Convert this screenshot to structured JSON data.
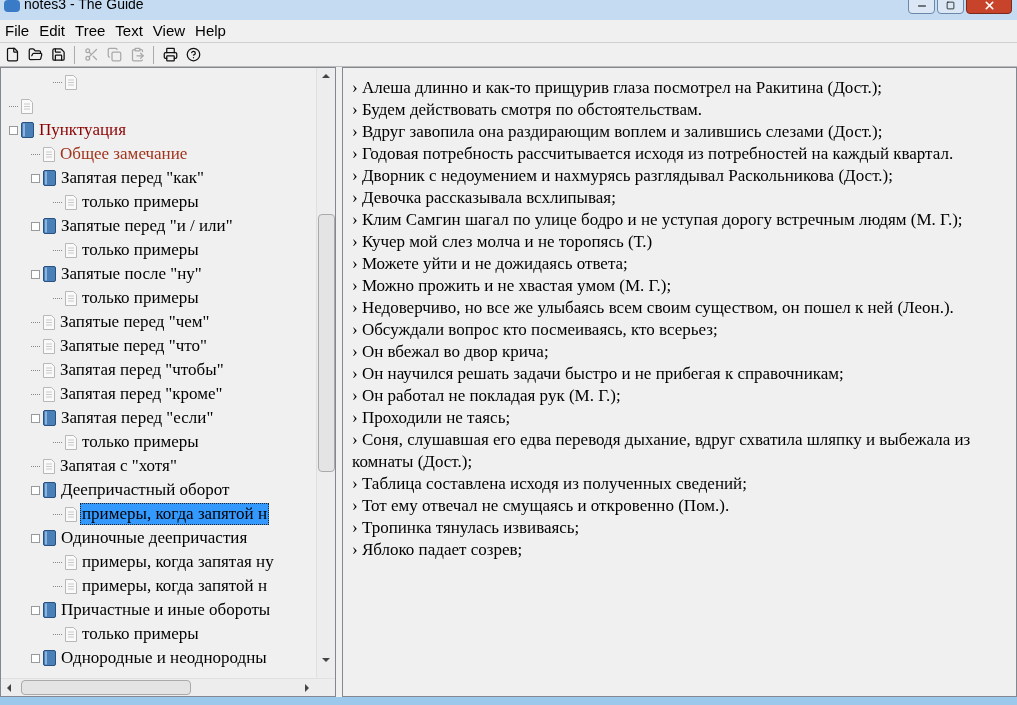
{
  "window": {
    "title": "notes3 - The Guide"
  },
  "menu": [
    "File",
    "Edit",
    "Tree",
    "Text",
    "View",
    "Help"
  ],
  "toolbar": [
    {
      "kind": "new",
      "disabled": false
    },
    {
      "kind": "open",
      "disabled": false
    },
    {
      "kind": "save",
      "disabled": false
    },
    {
      "kind": "separator"
    },
    {
      "kind": "cut",
      "disabled": true
    },
    {
      "kind": "copy",
      "disabled": true
    },
    {
      "kind": "paste",
      "disabled": true
    },
    {
      "kind": "separator"
    },
    {
      "kind": "print",
      "disabled": false
    },
    {
      "kind": "help",
      "disabled": false
    }
  ],
  "tree": {
    "items": [
      {
        "kind": "continued",
        "children": [
          {
            "kind": "continued",
            "children": [
              {
                "kind": "page"
              }
            ]
          }
        ]
      },
      {
        "kind": "page"
      },
      {
        "kind": "book",
        "label": "Пунктуация",
        "color": "#8b0000",
        "expanded": true,
        "selected": false,
        "children": [
          {
            "kind": "page",
            "label": "Общее замечание",
            "color": "#a0341c",
            "selected": false
          },
          {
            "kind": "book",
            "label": "Запятая перед \"как\"",
            "expanded": true,
            "selected": false,
            "children": [
              {
                "kind": "page",
                "label": "только примеры",
                "selected": false
              }
            ]
          },
          {
            "kind": "book",
            "label": "Запятые перед   \"и / или\"",
            "expanded": true,
            "selected": false,
            "children": [
              {
                "kind": "page",
                "label": "только примеры",
                "selected": false
              }
            ]
          },
          {
            "kind": "book",
            "label": "Запятые после \"ну\"",
            "expanded": true,
            "selected": false,
            "children": [
              {
                "kind": "page",
                "label": "только примеры",
                "selected": false
              }
            ]
          },
          {
            "kind": "page",
            "label": "Запятые перед \"чем\"",
            "selected": false
          },
          {
            "kind": "page",
            "label": "Запятые перед \"что\"",
            "selected": false
          },
          {
            "kind": "page",
            "label": "Запятая перед \"чтобы\"",
            "selected": false
          },
          {
            "kind": "page",
            "label": "Запятая перед \"кроме\"",
            "selected": false
          },
          {
            "kind": "book",
            "label": "Запятая перед \"если\"",
            "expanded": true,
            "selected": false,
            "children": [
              {
                "kind": "page",
                "label": "только примеры",
                "selected": false
              }
            ]
          },
          {
            "kind": "page",
            "label": "Запятая с \"хотя\"",
            "selected": false
          },
          {
            "kind": "book",
            "label": "Деепричастный оборот",
            "expanded": true,
            "selected": false,
            "children": [
              {
                "kind": "page",
                "label": "примеры, когда запятой н",
                "selected": true
              }
            ]
          },
          {
            "kind": "book",
            "label": "Одиночные деепричастия",
            "expanded": true,
            "selected": false,
            "children": [
              {
                "kind": "page",
                "label": "примеры, когда запятая ну",
                "selected": false
              },
              {
                "kind": "page",
                "label": "примеры, когда запятой н",
                "selected": false
              }
            ]
          },
          {
            "kind": "book",
            "label": "Причастные и иные обороты",
            "expanded": true,
            "selected": false,
            "children": [
              {
                "kind": "page",
                "label": "только примеры",
                "selected": false
              }
            ]
          },
          {
            "kind": "book",
            "label": "Однородные и неоднородны",
            "expanded": true,
            "selected": false
          }
        ]
      }
    ]
  },
  "text_lines": [
    "› Алеша длинно и как-то прищурив глаза посмотрел на Ракитина (Дост.);",
    "› Будем действовать смотря по обстоятельствам.",
    "› Вдруг завопила она раздирающим воплем и залившись слезами (Дост.);",
    "› Годовая потребность рассчитывается исходя из потребностей на каждый квартал.",
    "› Дворник с недоумением и нахмурясь разглядывал Раскольникова (Дост.);",
    "› Девочка рассказывала всхлипывая;",
    "› Клим Самгин шагал по улице бодро и не уступая дорогу встречным людям (М. Г.);",
    "› Кучер мой слез молча и не торопясь (Т.)",
    "› Можете уйти и не дожидаясь ответа;",
    "› Можно прожить и не хвастая умом (М. Г.);",
    "› Недоверчиво, но все же улыбаясь всем своим существом, он пошел к ней (Леон.).",
    "› Обсуждали вопрос кто посмеиваясь, кто всерьез;",
    "› Он вбежал во двор крича;",
    "› Он научился решать задачи быстро и не прибегая к справочникам;",
    "› Он работал не покладая рук (М. Г.);",
    "› Проходили не таясь;",
    "› Соня, слушавшая его едва переводя дыхание, вдруг схватила шляпку и выбежала из комнаты (Дост.);",
    "› Таблица составлена исходя из полученных сведений;",
    "› Тот ему отвечал не смущаясь и откровенно (Пом.).",
    "› Тропинка тянулась извиваясь;",
    "› Яблоко падает созрев;"
  ]
}
